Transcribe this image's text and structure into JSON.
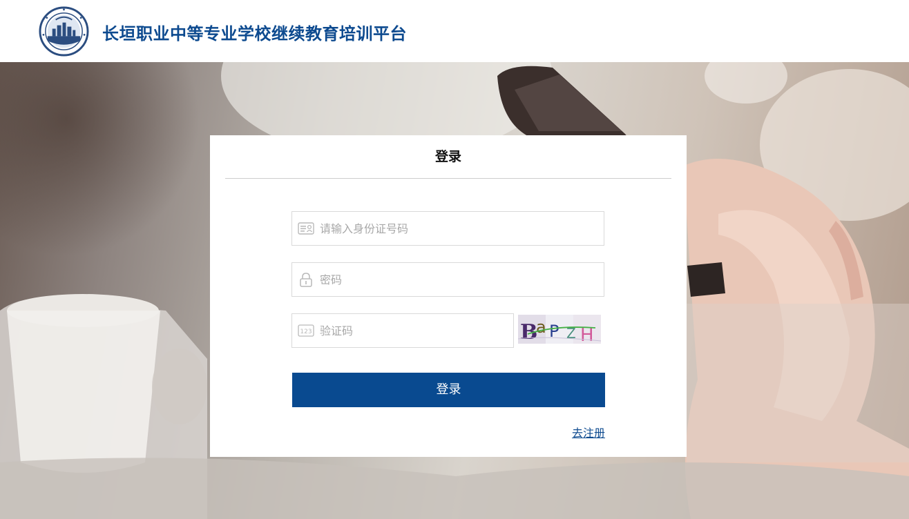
{
  "header": {
    "site_title": "长垣职业中等专业学校继续教育培训平台",
    "brand_color": "#0d4a8f"
  },
  "login_card": {
    "title": "登录",
    "id_field": {
      "placeholder": "请输入身份证号码",
      "value": "",
      "icon": "id-card-icon"
    },
    "password_field": {
      "placeholder": "密码",
      "value": "",
      "icon": "lock-icon"
    },
    "captcha_field": {
      "placeholder": "验证码",
      "value": "",
      "icon": "digits-123-icon"
    },
    "captcha_image_text": "BaPZH",
    "login_button": "登录",
    "login_button_color": "#094a90",
    "register_link": "去注册"
  }
}
